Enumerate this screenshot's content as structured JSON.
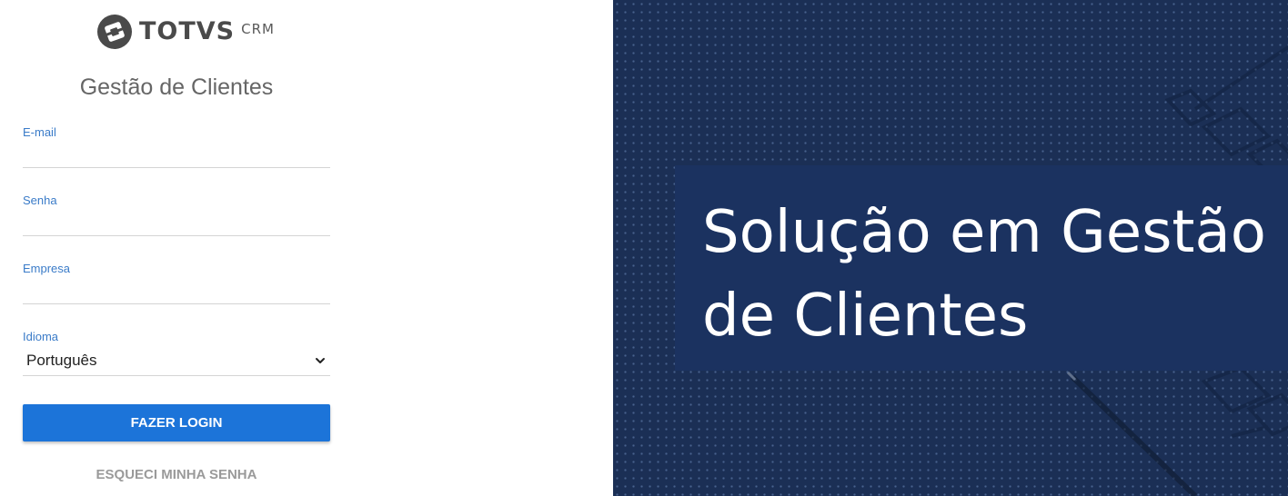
{
  "brand": {
    "name": "TOTVS",
    "product": "CRM",
    "logo_icon": "totvs-logo-icon",
    "text_color": "#4a4a4a"
  },
  "login": {
    "title": "Gestão de Clientes",
    "email": {
      "label": "E-mail",
      "value": ""
    },
    "password": {
      "label": "Senha",
      "value": ""
    },
    "company": {
      "label": "Empresa",
      "value": ""
    },
    "language": {
      "label": "Idioma",
      "selected": "Português"
    },
    "submit_label": "FAZER LOGIN",
    "forgot_label": "ESQUECI MINHA SENHA"
  },
  "hero": {
    "headline": "Solução em Gestão de Clientes"
  },
  "colors": {
    "accent": "#1c74d9",
    "label": "#3a7bc8",
    "hero_background": "#1b2f55",
    "hero_box": "#1b3260"
  }
}
